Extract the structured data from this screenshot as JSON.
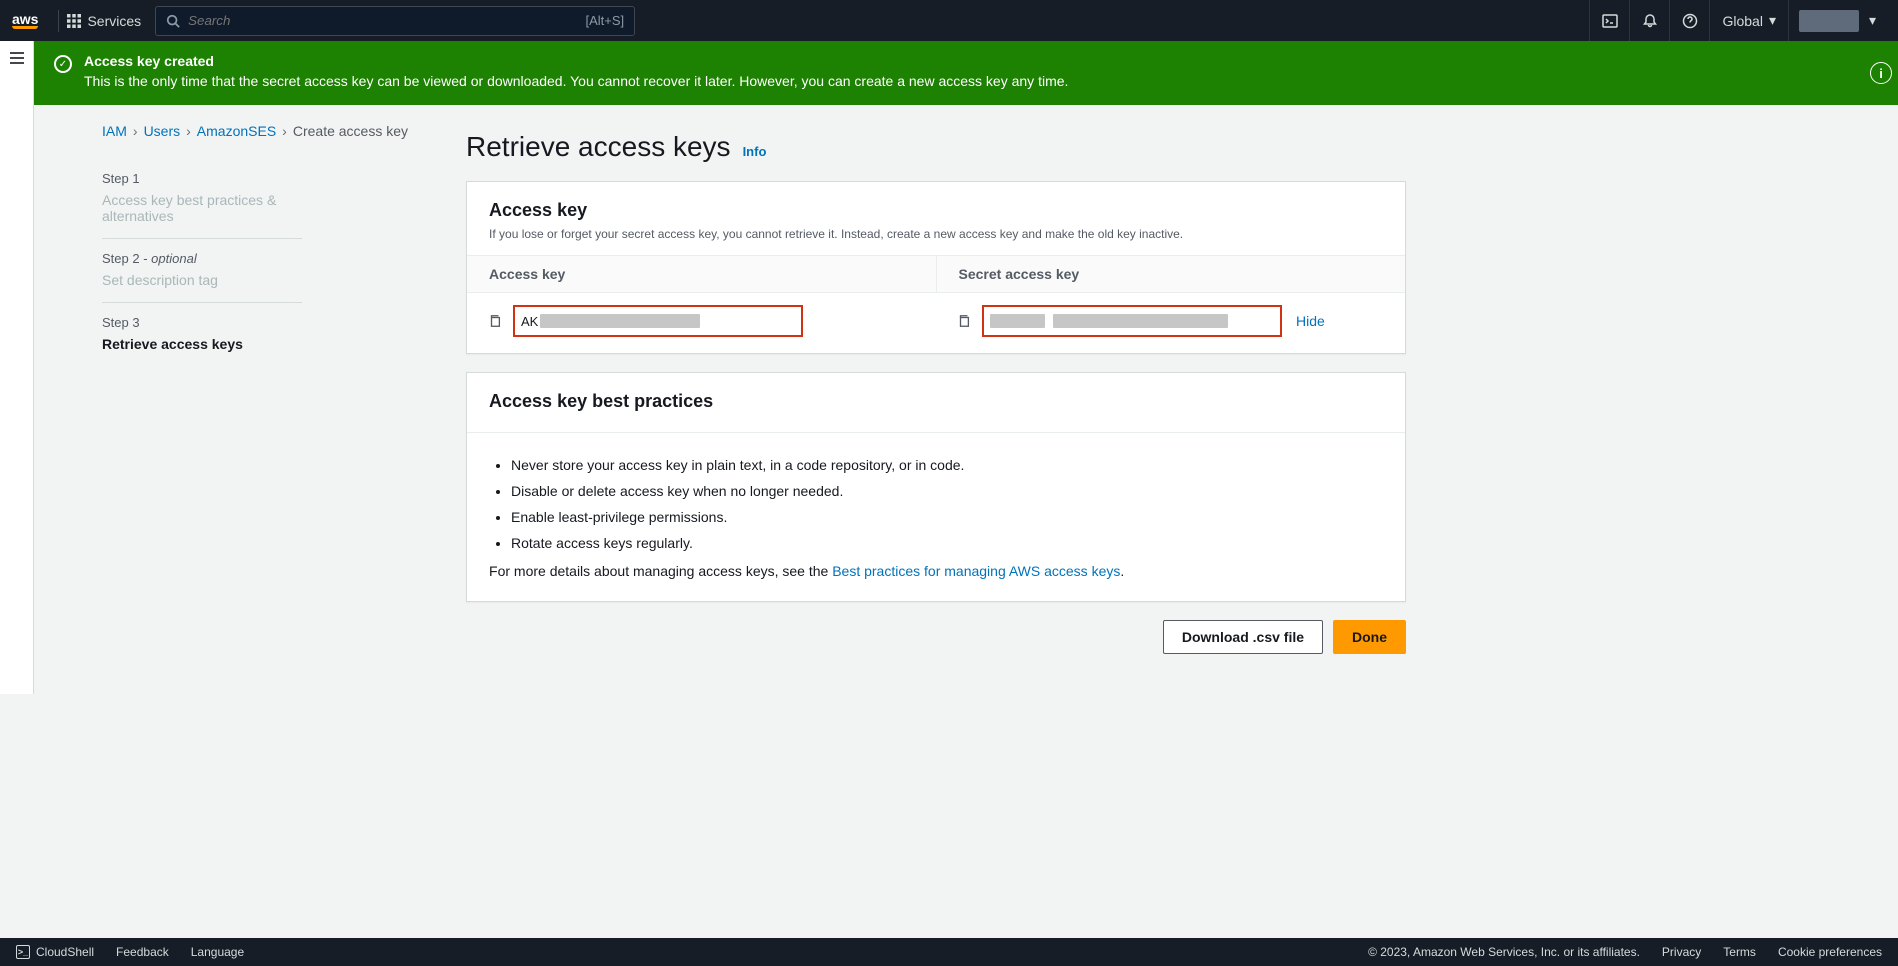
{
  "header": {
    "logo": "aws",
    "services_label": "Services",
    "search_placeholder": "Search",
    "search_hint": "[Alt+S]",
    "region": "Global",
    "account_placeholder": ""
  },
  "flash": {
    "title": "Access key created",
    "desc": "This is the only time that the secret access key can be viewed or downloaded. You cannot recover it later. However, you can create a new access key any time."
  },
  "breadcrumbs": {
    "items": [
      "IAM",
      "Users",
      "AmazonSES"
    ],
    "current": "Create access key"
  },
  "steps": [
    {
      "hd": "Step 1",
      "opt": "",
      "title": "Access key best practices & alternatives"
    },
    {
      "hd": "Step 2",
      "opt": "optional",
      "title": "Set description tag"
    },
    {
      "hd": "Step 3",
      "opt": "",
      "title": "Retrieve access keys"
    }
  ],
  "page": {
    "title": "Retrieve access keys",
    "info": "Info"
  },
  "access_card": {
    "heading": "Access key",
    "sub": "If you lose or forget your secret access key, you cannot retrieve it. Instead, create a new access key and make the old key inactive.",
    "col1": "Access key",
    "col2": "Secret access key",
    "value1_prefix": "AK",
    "hide_label": "Hide"
  },
  "bp_card": {
    "heading": "Access key best practices",
    "items": [
      "Never store your access key in plain text, in a code repository, or in code.",
      "Disable or delete access key when no longer needed.",
      "Enable least-privilege permissions.",
      "Rotate access keys regularly."
    ],
    "foot_prefix": "For more details about managing access keys, see the ",
    "foot_link": "Best practices for managing AWS access keys",
    "foot_suffix": "."
  },
  "actions": {
    "download": "Download .csv file",
    "done": "Done"
  },
  "footer": {
    "cloudshell": "CloudShell",
    "feedback": "Feedback",
    "language": "Language",
    "copyright": "© 2023, Amazon Web Services, Inc. or its affiliates.",
    "privacy": "Privacy",
    "terms": "Terms",
    "cookies": "Cookie preferences"
  }
}
